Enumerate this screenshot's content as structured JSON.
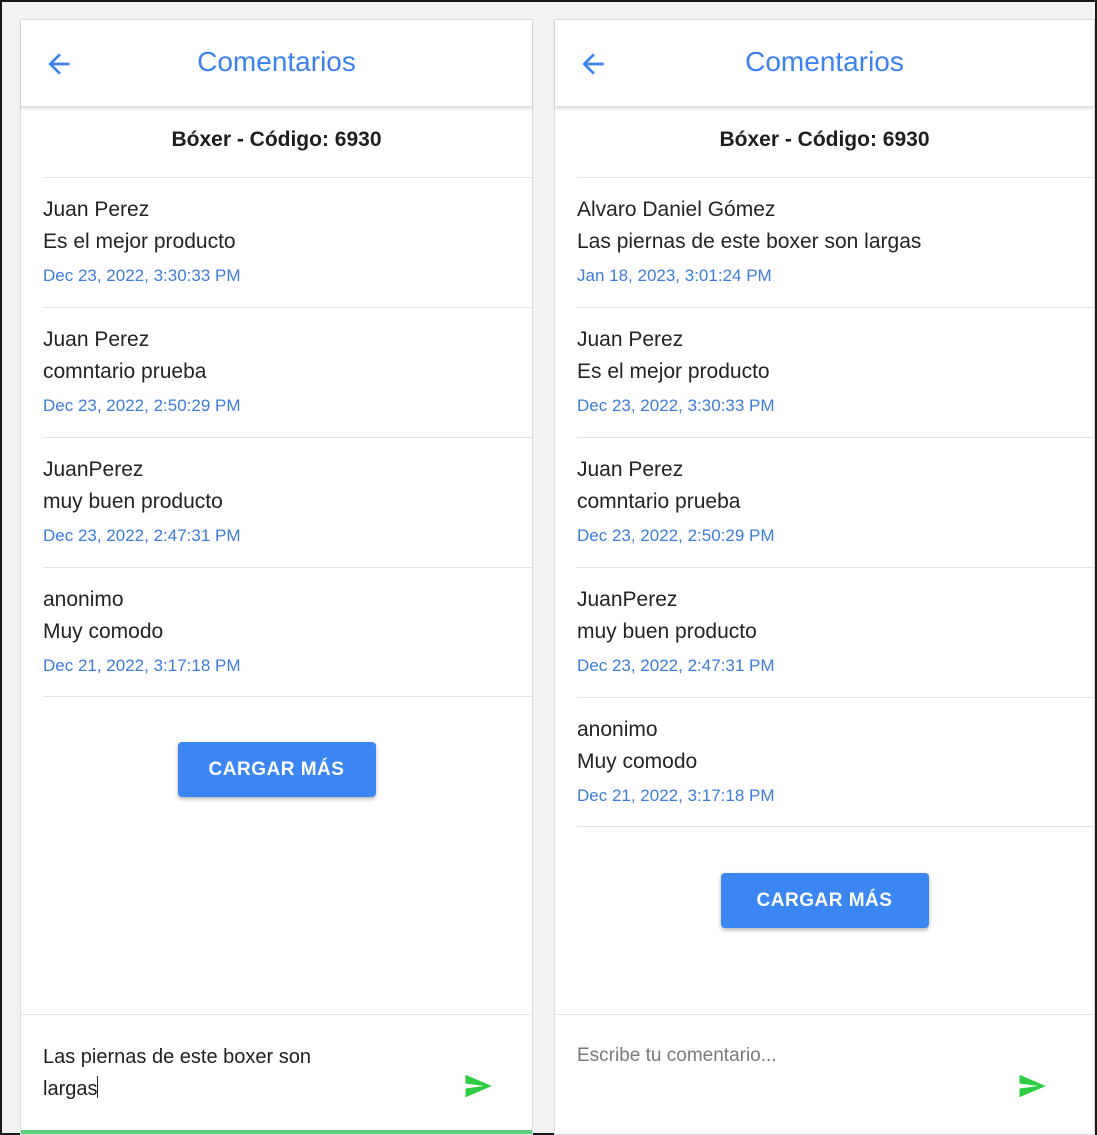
{
  "colors": {
    "accent": "#3b82f0",
    "send": "#2ecc40",
    "focus": "#5fd17e"
  },
  "left": {
    "title": "Comentarios",
    "product": "Bóxer - Código: 6930",
    "comments": [
      {
        "author": "Juan Perez",
        "text": "Es el mejor producto",
        "date": "Dec 23, 2022, 3:30:33 PM"
      },
      {
        "author": "Juan Perez",
        "text": "comntario prueba",
        "date": "Dec 23, 2022, 2:50:29 PM"
      },
      {
        "author": "JuanPerez",
        "text": "muy buen producto",
        "date": "Dec 23, 2022, 2:47:31 PM"
      },
      {
        "author": "anonimo",
        "text": "Muy comodo",
        "date": "Dec 21, 2022, 3:17:18 PM"
      }
    ],
    "load_more": "CARGAR MÁS",
    "input_value_line1": "Las piernas de este boxer son",
    "input_value_line2": "largas"
  },
  "right": {
    "title": "Comentarios",
    "product": "Bóxer - Código: 6930",
    "comments": [
      {
        "author": "Alvaro Daniel Gómez",
        "text": "Las piernas de este boxer son largas",
        "date": "Jan 18, 2023, 3:01:24 PM"
      },
      {
        "author": "Juan Perez",
        "text": "Es el mejor producto",
        "date": "Dec 23, 2022, 3:30:33 PM"
      },
      {
        "author": "Juan Perez",
        "text": "comntario prueba",
        "date": "Dec 23, 2022, 2:50:29 PM"
      },
      {
        "author": "JuanPerez",
        "text": "muy buen producto",
        "date": "Dec 23, 2022, 2:47:31 PM"
      },
      {
        "author": "anonimo",
        "text": "Muy comodo",
        "date": "Dec 21, 2022, 3:17:18 PM"
      }
    ],
    "load_more": "CARGAR MÁS",
    "input_placeholder": "Escribe tu comentario..."
  },
  "icons": {
    "back": "arrow-left-icon",
    "send": "send-icon"
  }
}
